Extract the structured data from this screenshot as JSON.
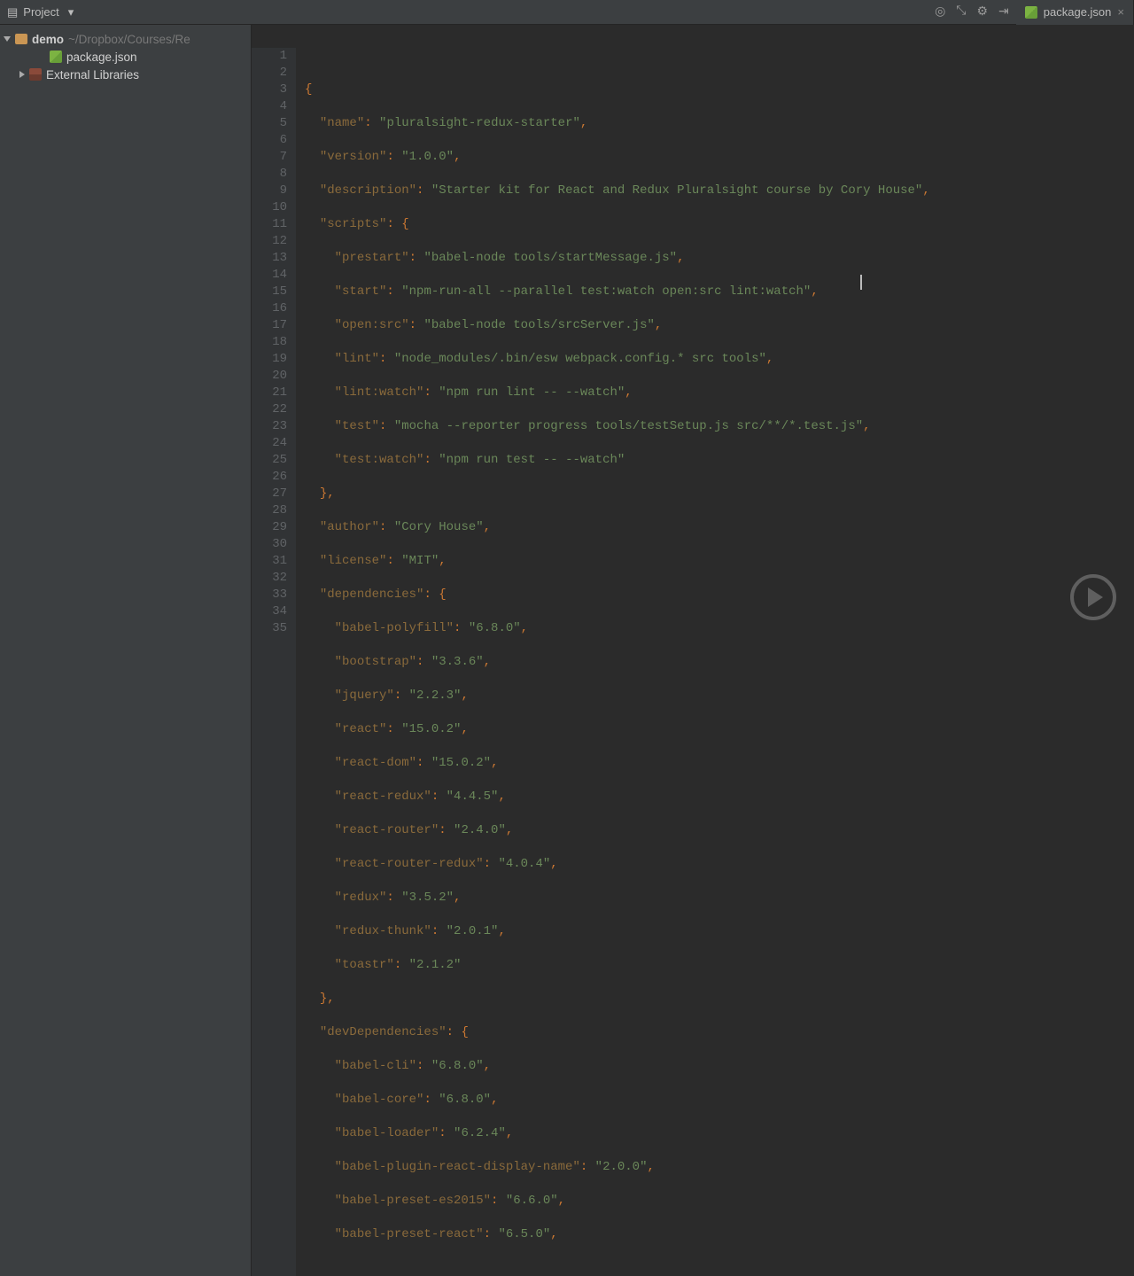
{
  "topbar": {
    "project_label": "Project"
  },
  "tab": {
    "filename": "package.json"
  },
  "tree": {
    "root_name": "demo",
    "root_path": "~/Dropbox/Courses/Re",
    "file1": "package.json",
    "ext_libs": "External Libraries"
  },
  "lines": [
    "1",
    "2",
    "3",
    "4",
    "5",
    "6",
    "7",
    "8",
    "9",
    "10",
    "11",
    "12",
    "13",
    "14",
    "15",
    "16",
    "17",
    "18",
    "19",
    "20",
    "21",
    "22",
    "23",
    "24",
    "25",
    "26",
    "27",
    "28",
    "29",
    "30",
    "31",
    "32",
    "33",
    "34",
    "35"
  ],
  "code": {
    "ln1": "{",
    "k2": "\"name\"",
    "v2": "\"pluralsight-redux-starter\"",
    "k3": "\"version\"",
    "v3": "\"1.0.0\"",
    "k4": "\"description\"",
    "v4": "\"Starter kit for React and Redux Pluralsight course by Cory House\"",
    "k5": "\"scripts\"",
    "k6": "\"prestart\"",
    "v6": "\"babel-node tools/startMessage.js\"",
    "k7": "\"start\"",
    "v7": "\"npm-run-all --parallel test:watch open:src lint:watch\"",
    "k8": "\"open:src\"",
    "v8": "\"babel-node tools/srcServer.js\"",
    "k9": "\"lint\"",
    "v9": "\"node_modules/.bin/esw webpack.config.* src tools\"",
    "k10": "\"lint:watch\"",
    "v10": "\"npm run lint -- --watch\"",
    "k11": "\"test\"",
    "v11": "\"mocha --reporter progress tools/testSetup.js src/**/*.test.js\"",
    "k12": "\"test:watch\"",
    "v12": "\"npm run test -- --watch\"",
    "k14": "\"author\"",
    "v14": "\"Cory House\"",
    "k15": "\"license\"",
    "v15": "\"MIT\"",
    "k16": "\"dependencies\"",
    "k17": "\"babel-polyfill\"",
    "v17": "\"6.8.0\"",
    "k18": "\"bootstrap\"",
    "v18": "\"3.3.6\"",
    "k19": "\"jquery\"",
    "v19": "\"2.2.3\"",
    "k20": "\"react\"",
    "v20": "\"15.0.2\"",
    "k21": "\"react-dom\"",
    "v21": "\"15.0.2\"",
    "k22": "\"react-redux\"",
    "v22": "\"4.4.5\"",
    "k23": "\"react-router\"",
    "v23": "\"2.4.0\"",
    "k24": "\"react-router-redux\"",
    "v24": "\"4.0.4\"",
    "k25": "\"redux\"",
    "v25": "\"3.5.2\"",
    "k26": "\"redux-thunk\"",
    "v26": "\"2.0.1\"",
    "k27": "\"toastr\"",
    "v27": "\"2.1.2\"",
    "k29": "\"devDependencies\"",
    "k30": "\"babel-cli\"",
    "v30": "\"6.8.0\"",
    "k31": "\"babel-core\"",
    "v31": "\"6.8.0\"",
    "k32": "\"babel-loader\"",
    "v32": "\"6.2.4\"",
    "k33": "\"babel-plugin-react-display-name\"",
    "v33": "\"2.0.0\"",
    "k34": "\"babel-preset-es2015\"",
    "v34": "\"6.6.0\"",
    "k35": "\"babel-preset-react\"",
    "v35": "\"6.5.0\""
  }
}
